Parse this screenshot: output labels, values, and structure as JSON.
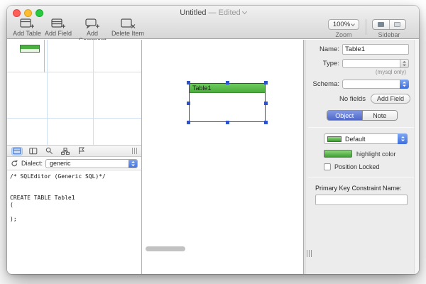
{
  "window": {
    "title": "Untitled",
    "edited": "— Edited"
  },
  "toolbar": {
    "buttons": [
      {
        "label": "Add Table"
      },
      {
        "label": "Add Field"
      },
      {
        "label": "Add Comment"
      },
      {
        "label": "Delete Item"
      }
    ],
    "zoom": {
      "value": "100%",
      "label": "Zoom"
    },
    "sidebar_toggle": {
      "label": "Sidebar"
    }
  },
  "sql_panel": {
    "dialect_label": "Dialect:",
    "dialect_value": "generic",
    "lines": [
      "/* SQLEditor (Generic SQL)*/",
      "",
      "",
      "CREATE TABLE Table1",
      "(",
      "",
      ");"
    ]
  },
  "canvas": {
    "table": {
      "title": "Table1"
    }
  },
  "inspector": {
    "name_label": "Name:",
    "name_value": "Table1",
    "type_label": "Type:",
    "type_note": "(mysql only)",
    "schema_label": "Schema:",
    "fields_status": "No fields",
    "add_field_button": "Add Field",
    "tab_object": "Object",
    "tab_note": "Note",
    "color_value": "Default",
    "highlight_label": "highlight color",
    "position_locked_label": "Position Locked",
    "pk_label": "Primary Key Constraint Name:"
  },
  "icons": {
    "toolbar": [
      "add-table-icon",
      "add-field-icon",
      "add-comment-icon",
      "delete-item-icon"
    ],
    "sql_strip": [
      "table-view-icon",
      "columns-view-icon",
      "search-icon",
      "hierarchy-icon",
      "flag-icon"
    ],
    "misc": [
      "refresh-icon",
      "chevron-down-icon",
      "popup-arrows-icon",
      "traffic-light-close",
      "traffic-light-minimize",
      "traffic-light-zoom"
    ]
  },
  "colors": {
    "table_header_green": "#5abf4e",
    "selection_handle_blue": "#2d52cc",
    "segment_active_blue": "#5a73d4",
    "grid_blue": "#cfe0f3",
    "popup_cap_blue": "#4f7ce4"
  }
}
